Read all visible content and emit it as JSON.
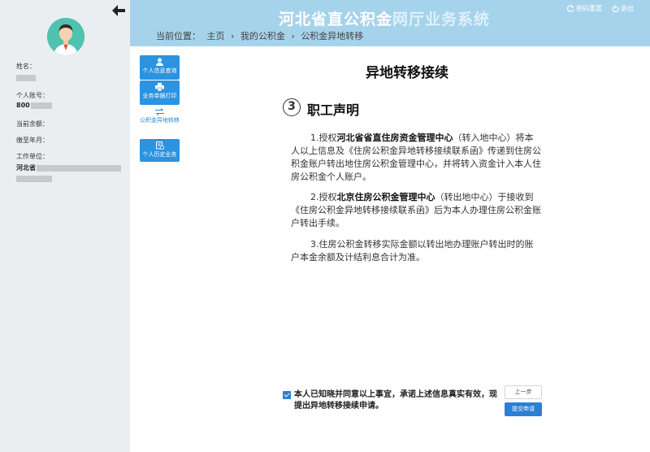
{
  "header": {
    "title_part1": "河北省直公积金",
    "title_part2": "网厅业务系统",
    "change_password": "密码重置",
    "logout": "退出"
  },
  "breadcrumb": {
    "prefix": "当前位置：",
    "items": [
      "主页",
      "我的公积金",
      "公积金异地转移"
    ],
    "separator": "›"
  },
  "user": {
    "name_label": "姓名：",
    "account_label": "个人账号：",
    "account_prefix": "800",
    "balance_label": "当前余额：",
    "paid_until_label": "缴至年月：",
    "work_unit_label": "工作单位：",
    "work_unit_prefix": "河北省"
  },
  "subnav": {
    "items": [
      {
        "label": "个人信息查询",
        "icon": "user-icon"
      },
      {
        "label": "业务单据打印",
        "icon": "printer-icon"
      },
      {
        "label": "公积金异地转移",
        "icon": "transfer-icon"
      },
      {
        "label": "个人历史业务",
        "icon": "history-icon"
      }
    ]
  },
  "main": {
    "title": "异地转移接续",
    "step_number": "3",
    "section_title": "职工声明",
    "para1_a": "1.授权",
    "para1_b": "河北省省直住房资金管理中心",
    "para1_c": "（转入地中心）将本人以上信息及《住房公积金异地转移接续联系函》传递到住房公积金账户转出地住房公积金管理中心，并将转入资金计入本人住房公积金个人账户。",
    "para2_a": "2.授权",
    "para2_b": "北京住房公积金管理中心",
    "para2_c": "（转出地中心）于接收到《住房公积金异地转移接续联系函》后为本人办理住房公积金账户转出手续。",
    "para3": "3.住房公积金转移实际金额以转出地办理账户转出时的账户本金余额及计结利息合计为准。"
  },
  "footer": {
    "agree_text": "本人已知晓并同意以上事宜，承诺上述信息真实有效，现提出异地转移接续申请。",
    "agree_checked": true,
    "prev_button": "上一步",
    "submit_button": "提交申请"
  },
  "colors": {
    "header_bg": "#a6d3ec",
    "sidebar_bg": "#ebeef1",
    "accent": "#2b93e0"
  }
}
